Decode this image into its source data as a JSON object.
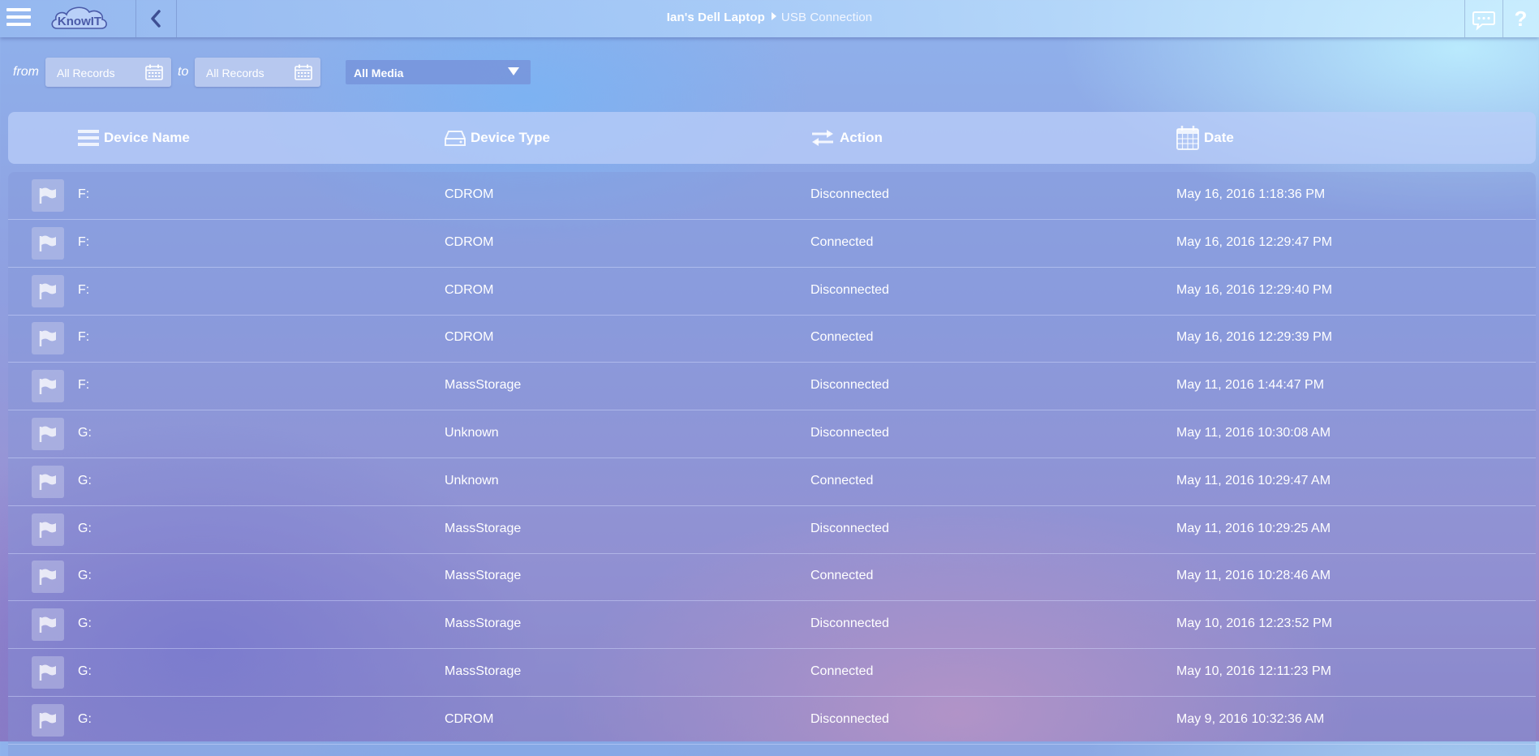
{
  "app": {
    "logo_text": "KnowIT",
    "breadcrumb": [
      "Ian's Dell Laptop",
      "USB Connection"
    ],
    "help_label": "?"
  },
  "filters": {
    "from_label": "from",
    "to_label": "to",
    "from_value": "All Records",
    "to_value": "All Records",
    "media_value": "All Media"
  },
  "table": {
    "headers": [
      "Device Name",
      "Device Type",
      "Action",
      "Date"
    ],
    "rows": [
      [
        "F:",
        "CDROM",
        "Disconnected",
        "May 16, 2016 1:18:36 PM"
      ],
      [
        "F:",
        "CDROM",
        "Connected",
        "May 16, 2016 12:29:47 PM"
      ],
      [
        "F:",
        "CDROM",
        "Disconnected",
        "May 16, 2016 12:29:40 PM"
      ],
      [
        "F:",
        "CDROM",
        "Connected",
        "May 16, 2016 12:29:39 PM"
      ],
      [
        "F:",
        "MassStorage",
        "Disconnected",
        "May 11, 2016 1:44:47 PM"
      ],
      [
        "G:",
        "Unknown",
        "Disconnected",
        "May 11, 2016 10:30:08 AM"
      ],
      [
        "G:",
        "Unknown",
        "Connected",
        "May 11, 2016 10:29:47 AM"
      ],
      [
        "G:",
        "MassStorage",
        "Disconnected",
        "May 11, 2016 10:29:25 AM"
      ],
      [
        "G:",
        "MassStorage",
        "Connected",
        "May 11, 2016 10:28:46 AM"
      ],
      [
        "G:",
        "MassStorage",
        "Disconnected",
        "May 10, 2016 12:23:52 PM"
      ],
      [
        "G:",
        "MassStorage",
        "Connected",
        "May 10, 2016 12:11:23 PM"
      ],
      [
        "G:",
        "CDROM",
        "Disconnected",
        "May 9, 2016 10:32:36 AM"
      ]
    ]
  },
  "icons": {
    "menu": "hamburger-icon",
    "back": "chevron-left-icon",
    "chat": "chat-bubble-icon",
    "help": "question-mark-icon",
    "calendar": "calendar-icon",
    "dropdown": "triangle-down-icon",
    "device_name": "list-icon",
    "device_type": "drive-icon",
    "action": "swap-arrows-icon",
    "date": "calendar-icon",
    "flag": "flag-icon"
  },
  "colors": {
    "text": "#ffffff",
    "logo": "#4a5aa8"
  }
}
